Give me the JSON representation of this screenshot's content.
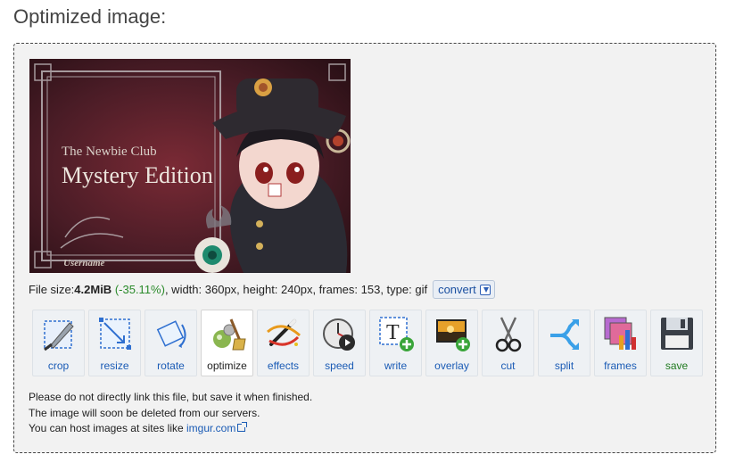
{
  "page": {
    "title": "Optimized image:"
  },
  "preview": {
    "line1": "The Newbie Club",
    "line2": "Mystery Edition",
    "username": "Username"
  },
  "file_info": {
    "size_label": "File size: ",
    "size_value": "4.2MiB",
    "reduction": "(-35.11%)",
    "details": ", width: 360px, height: 240px, frames: 153, type: gif",
    "convert_label": "convert"
  },
  "tools": [
    {
      "label": "crop",
      "icon": "crop-icon"
    },
    {
      "label": "resize",
      "icon": "resize-icon"
    },
    {
      "label": "rotate",
      "icon": "rotate-icon"
    },
    {
      "label": "optimize",
      "icon": "optimize-icon"
    },
    {
      "label": "effects",
      "icon": "effects-icon"
    },
    {
      "label": "speed",
      "icon": "speed-icon"
    },
    {
      "label": "write",
      "icon": "write-icon"
    },
    {
      "label": "overlay",
      "icon": "overlay-icon"
    },
    {
      "label": "cut",
      "icon": "cut-icon"
    },
    {
      "label": "split",
      "icon": "split-icon"
    },
    {
      "label": "frames",
      "icon": "frames-icon"
    },
    {
      "label": "save",
      "icon": "save-icon"
    }
  ],
  "notes": {
    "line1": "Please do not directly link this file, but save it when finished.",
    "line2": "The image will soon be deleted from our servers.",
    "line3_prefix": "You can host images at sites like ",
    "line3_link": "imgur.com"
  },
  "colors": {
    "reduction_green": "#2a8a2a",
    "link_blue": "#1a5bb5",
    "panel_bg": "#f2f2f2"
  }
}
